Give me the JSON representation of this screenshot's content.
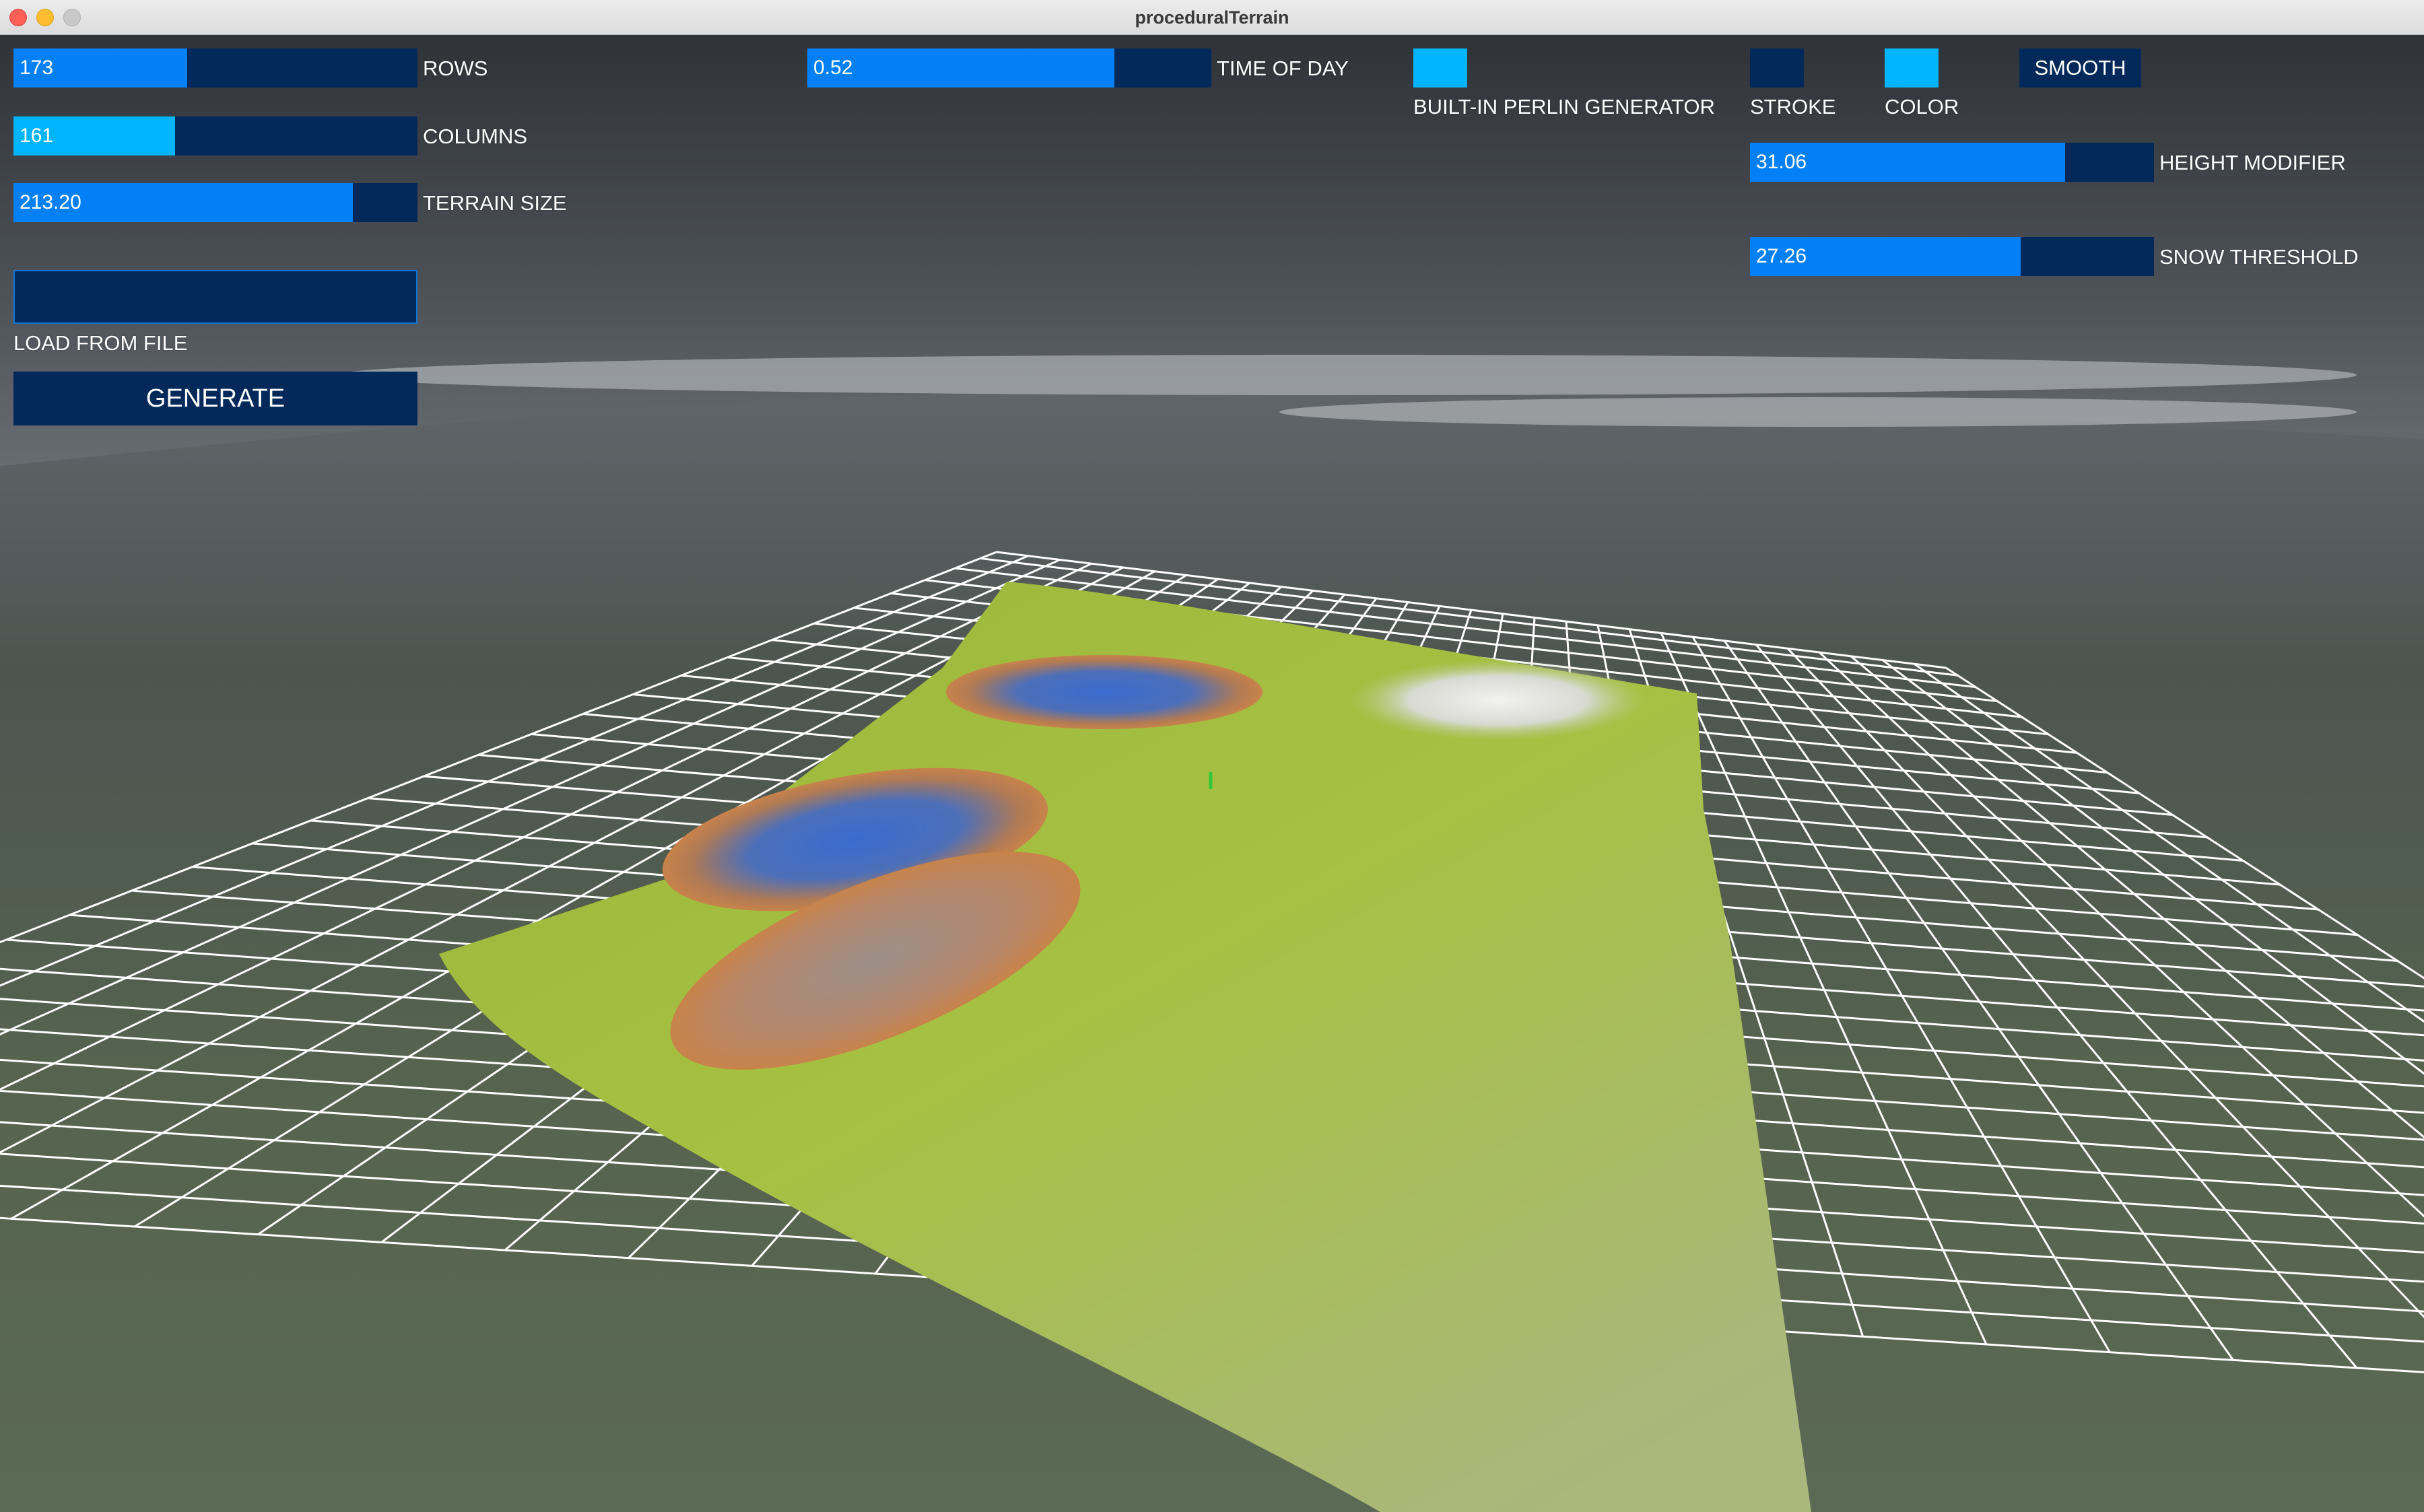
{
  "window": {
    "title": "proceduralTerrain"
  },
  "controls": {
    "rows": {
      "label": "ROWS",
      "value": "173",
      "fill_fraction": 0.43
    },
    "columns": {
      "label": "COLUMNS",
      "value": "161",
      "fill_fraction": 0.4
    },
    "terrain_size": {
      "label": "TERRAIN SIZE",
      "value": "213.20",
      "fill_fraction": 0.84
    },
    "time_of_day": {
      "label": "TIME OF DAY",
      "value": "0.52",
      "fill_fraction": 0.76
    },
    "height_modifier": {
      "label": "HEIGHT MODIFIER",
      "value": "31.06",
      "fill_fraction": 0.78
    },
    "snow_threshold": {
      "label": "SNOW THRESHOLD",
      "value": "27.26",
      "fill_fraction": 0.67
    },
    "load_from_file": {
      "label": "LOAD FROM FILE",
      "value": ""
    },
    "generate_button": {
      "label": "GENERATE"
    },
    "smooth_button": {
      "label": "SMOOTH"
    },
    "perlin_toggle": {
      "label": "BUILT-IN PERLIN GENERATOR",
      "on": true
    },
    "stroke_toggle": {
      "label": "STROKE",
      "on": false
    },
    "color_toggle": {
      "label": "COLOR",
      "on": true
    }
  },
  "colors": {
    "control_bg": "#02295a",
    "control_fill": "#0380f5",
    "toggle_on": "#00b4ff",
    "toggle_off": "#02295a",
    "label_text": "#ffffff",
    "terrain_green": "#a8c63e",
    "water_blue": "#3c6fc4",
    "shore_orange": "#c77b4b",
    "grid_line": "#ffffff"
  }
}
